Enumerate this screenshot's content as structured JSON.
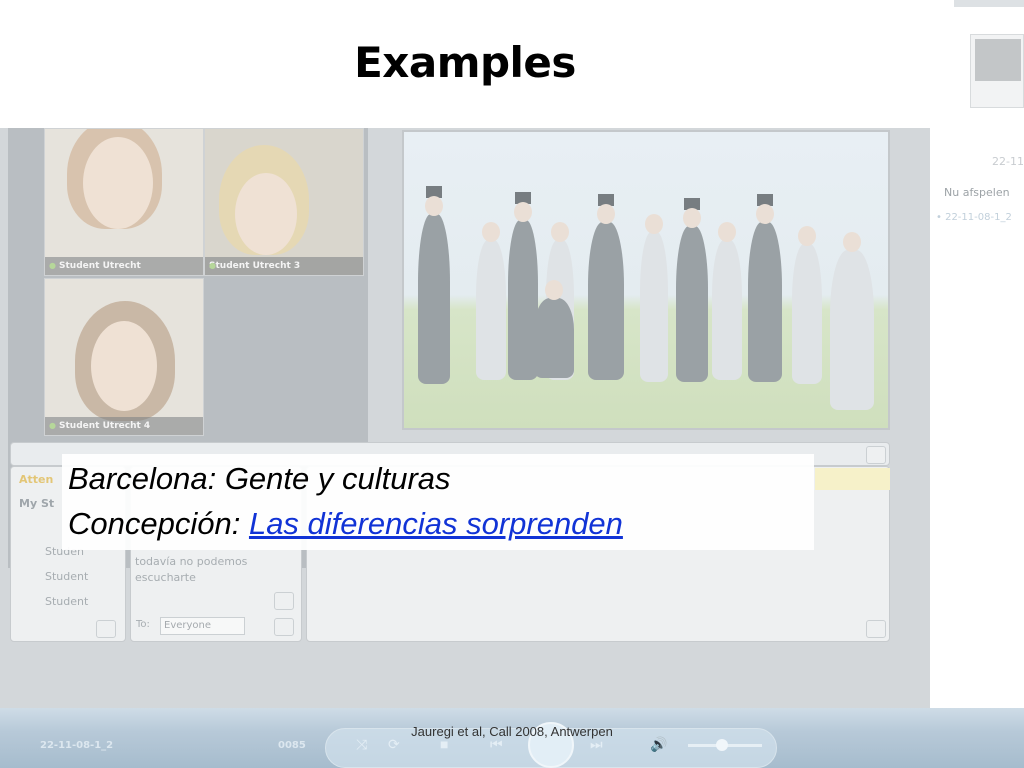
{
  "slide": {
    "title": "Examples",
    "line1": "Barcelona: Gente y culturas",
    "line2_prefix": "Concepción: ",
    "line2_link": "Las diferencias sorprenden",
    "footer": "Jauregi et al, Call 2008, Antwerpen"
  },
  "screenshot": {
    "videos": [
      {
        "caption": "Student Utrecht"
      },
      {
        "caption": "Student Utrecht 3"
      },
      {
        "caption": "Student Utrecht 4"
      }
    ],
    "attendees_partial": "Atten",
    "my_st_partial": "My St",
    "students": [
      "Studen",
      "Student",
      "Student"
    ],
    "chat_lines": [
      "todavía no podemos",
      "escucharte"
    ],
    "to_label": "To:",
    "to_value": "Everyone"
  },
  "media_player": {
    "now_playing_label": "Nu afspelen",
    "playlist_item": "22-11-08-1_2",
    "date_partial": "22-11",
    "track_label": "22-11-08-1_2",
    "time": "0085"
  },
  "colors": {
    "link": "#1133d6"
  }
}
